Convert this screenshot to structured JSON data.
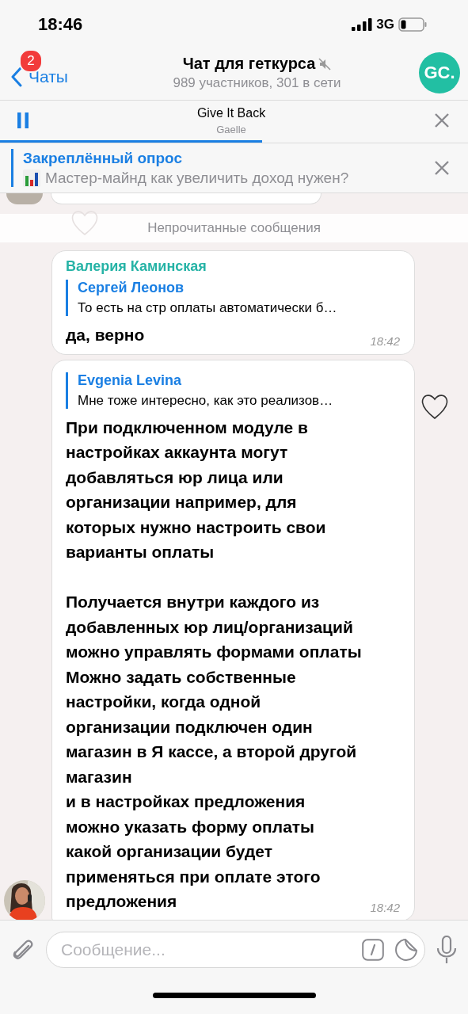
{
  "status_bar": {
    "time": "18:46",
    "network": "3G"
  },
  "header": {
    "back_label": "Чаты",
    "unread_badge": "2",
    "title": "Чат для геткурса",
    "muted": true,
    "subtitle": "989 участников, 301 в сети",
    "avatar_initials": "GC."
  },
  "player": {
    "title": "Give It Back",
    "artist": "Gaelle",
    "playing": true,
    "level": 0.56
  },
  "pinned": {
    "label": "Закреплённый опрос",
    "text": "Мастер-майнд как увеличить доход нужен?"
  },
  "unread_divider": "Непрочитанные сообщения",
  "messages": [
    {
      "sender": "Валерия Каминская",
      "color": "#26b3a6",
      "reply": {
        "author": "Сергей Леонов",
        "text": "То есть на стр оплаты автоматически б…"
      },
      "text": "да, верно",
      "time": "18:42",
      "avatar": false
    },
    {
      "reply": {
        "author": "Evgenia Levina",
        "text": "Мне тоже интересно, как это реализов…"
      },
      "text": "При подключенном модуле в\nнастройках аккаунта могут\nдобавляться юр лица или\nорганизации например, для\nкоторых нужно настроить свои\nварианты оплаты\n\nПолучается внутри каждого из\nдобавленных юр лиц/организаций\nможно управлять формами оплаты\nМожно задать собственные\nнастройки, когда одной\nорганизации подключен один\nмагазин в Я кассе, а второй другой\nмагазин\nи в настройках предложения\nможно указать форму оплаты\nкакой организации будет\nприменяться при оплате этого\nпредложения",
      "time": "18:42",
      "avatar": true
    }
  ],
  "composer": {
    "placeholder": "Сообщение..."
  }
}
